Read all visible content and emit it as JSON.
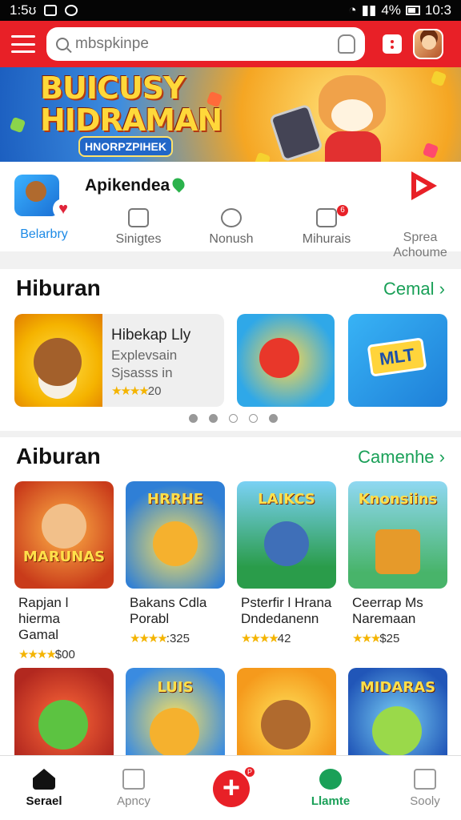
{
  "status_bar": {
    "time": "1:5ʊ",
    "battery": "4%",
    "clock": "10:3"
  },
  "search": {
    "placeholder": "mbspkinpe"
  },
  "banner": {
    "title_line1": "BUICUSY",
    "title_line2": "HIDRAMAN",
    "subtitle": "HNORPZPIHEK"
  },
  "quick_nav": {
    "app_name": "Apikendea",
    "tabs": [
      {
        "label": "Belarbry",
        "icon": "app-icon"
      },
      {
        "label": "Sinigtes",
        "icon": "photo-icon"
      },
      {
        "label": "Nonush",
        "icon": "circle-icon"
      },
      {
        "label": "Mihurais",
        "icon": "image-icon",
        "badge": "6"
      },
      {
        "label": "Spreа\nAchoume",
        "icon": "text-icon"
      }
    ]
  },
  "section1": {
    "title": "Hiburan",
    "more": "Cemal",
    "featured": {
      "title": "Hibekap Lly",
      "line2": "Explevsain",
      "line3": "Sjsasss in",
      "rating": "20"
    },
    "card3_label": "MLT",
    "dots": [
      false,
      false,
      false,
      false,
      true
    ]
  },
  "section2": {
    "title": "Aiburan",
    "more": "Camenhe",
    "tiles": [
      {
        "emblem": "MARUNAS",
        "name1": "Rapjan l hierma",
        "name2": "Gamal",
        "rating": "$00",
        "bg": "#c93b1a"
      },
      {
        "emblem": "HRRHE",
        "name1": "Bakans Cdla",
        "name2": "Porabl",
        "rating": ":325",
        "bg": "#2f7fd6"
      },
      {
        "emblem": "LAIKCS",
        "name1": "Psterfir l Hrana",
        "name2": "Dndedanenn",
        "rating": "42",
        "bg": "#2a9c4a"
      },
      {
        "emblem": "Knonsiins",
        "name1": "Ceerrap Ms",
        "name2": "Naremaan",
        "rating": "$25",
        "bg": "#48b46a"
      }
    ],
    "tiles_row2": [
      {
        "emblem": "",
        "bg": "#b2281f"
      },
      {
        "emblem": "LUIS",
        "bg": "#3a8be0"
      },
      {
        "emblem": "",
        "bg": "#f59a1c"
      },
      {
        "emblem": "MIDARAS",
        "bg": "#2156b8"
      }
    ]
  },
  "bottom_nav": [
    {
      "label": "Serael",
      "icon": "home-icon"
    },
    {
      "label": "Apncy",
      "icon": "search-doc-icon"
    },
    {
      "label": "",
      "icon": "add-icon"
    },
    {
      "label": "Llamte",
      "icon": "live-icon"
    },
    {
      "label": "Sooly",
      "icon": "share-icon"
    }
  ],
  "fab_badge": "P",
  "colors": {
    "brand_red": "#e82027",
    "accent_green": "#1aa058",
    "link_blue": "#1c8ae6",
    "star": "#f4b400"
  }
}
